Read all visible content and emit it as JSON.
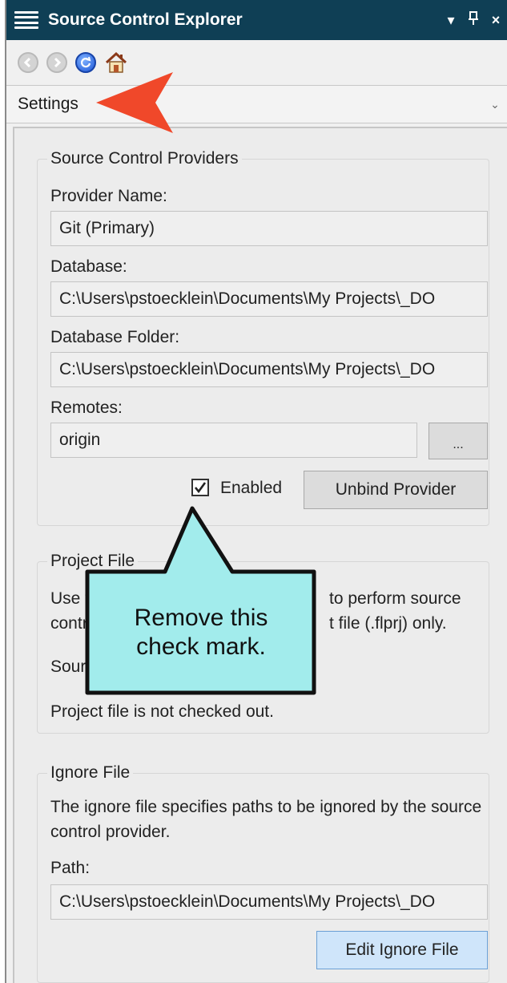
{
  "window": {
    "title": "Source Control Explorer",
    "controls": [
      "▾",
      "⊥",
      "×"
    ]
  },
  "toolbar": {
    "back_icon": "back-arrow-icon",
    "forward_icon": "forward-arrow-icon",
    "refresh_icon": "refresh-icon",
    "home_icon": "home-icon"
  },
  "view_select": {
    "value": "Settings"
  },
  "source_control_providers": {
    "title": "Source Control Providers",
    "provider_name_label": "Provider Name:",
    "provider_name_value": "Git (Primary)",
    "database_label": "Database:",
    "database_value": "C:\\Users\\pstoecklein\\Documents\\My Projects\\_DO",
    "database_folder_label": "Database Folder:",
    "database_folder_value": "C:\\Users\\pstoecklein\\Documents\\My Projects\\_DO",
    "remotes_label": "Remotes:",
    "remotes_value": "origin",
    "remotes_button": "...",
    "enabled_label": "Enabled",
    "enabled_checked": true,
    "unbind_button": "Unbind Provider"
  },
  "project_file": {
    "title": "Project File",
    "line1_left": "Use t",
    "line1_right": "to perform source",
    "line2_left": "contr",
    "line2_right": "t file (.flprj) only.",
    "status_label_fragment": "Sourc",
    "status_text": "Project file is not checked out."
  },
  "ignore_file": {
    "title": "Ignore File",
    "description": "The ignore file specifies paths to be ignored by the source control provider.",
    "path_label": "Path:",
    "path_value": "C:\\Users\\pstoecklein\\Documents\\My Projects\\_DO",
    "edit_button": "Edit Ignore File"
  },
  "callout": {
    "text_line1": "Remove this",
    "text_line2": "check mark."
  },
  "colors": {
    "titlebar": "#0f3f55",
    "callout_fill": "#a2ecec",
    "arrow": "#f0482a"
  }
}
